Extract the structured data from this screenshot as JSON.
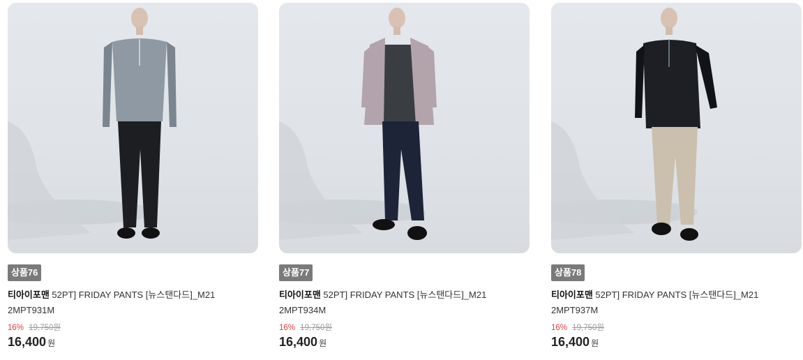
{
  "products": [
    {
      "badge": "상품76",
      "brand": "티아이포맨",
      "name": " 52PT] FRIDAY PANTS [뉴스탠다드]_M212MPT931M",
      "discount": "16%",
      "original_price": "19,750원",
      "price": "16,400",
      "currency": "원",
      "top_color": "#8f99a3",
      "top_dark": "#7b858f",
      "pants_color": "#1c1e22",
      "jacket": false
    },
    {
      "badge": "상품77",
      "brand": "티아이포맨",
      "name": " 52PT] FRIDAY PANTS [뉴스탠다드]_M212MPT934M",
      "discount": "16%",
      "original_price": "19,750원",
      "price": "16,400",
      "currency": "원",
      "top_color": "#b3a3ab",
      "top_dark": "#3a3d42",
      "pants_color": "#1e2438",
      "jacket": true
    },
    {
      "badge": "상품78",
      "brand": "티아이포맨",
      "name": " 52PT] FRIDAY PANTS [뉴스탠다드]_M212MPT937M",
      "discount": "16%",
      "original_price": "19,750원",
      "price": "16,400",
      "currency": "원",
      "top_color": "#1d1f24",
      "top_dark": "#121317",
      "pants_color": "#cbbfae",
      "jacket": false
    }
  ]
}
